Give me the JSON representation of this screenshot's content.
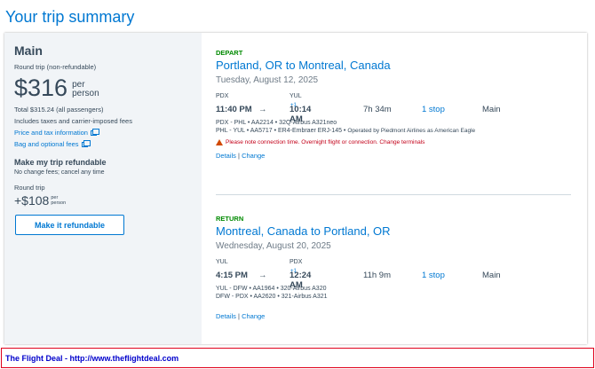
{
  "page_title": "Your trip summary",
  "sidebar": {
    "fare_name": "Main",
    "trip_type": "Round trip (non-refundable)",
    "price": "$316",
    "per_line1": "per",
    "per_line2": "person",
    "total": "Total $315.24 (all passengers)",
    "includes": "Includes taxes and carrier-imposed fees",
    "price_tax_link": "Price and tax information",
    "bag_link": "Bag and optional fees",
    "refundable_heading": "Make my trip refundable",
    "no_change_fees": "No change fees; cancel any time",
    "round_trip_label": "Round trip",
    "upsell_price": "+$108",
    "upsell_per1": "per",
    "upsell_per2": "person",
    "refund_button": "Make it refundable"
  },
  "depart": {
    "tag": "DEPART",
    "route": "Portland, OR to Montreal, Canada",
    "date": "Tuesday, August 12, 2025",
    "from_code": "PDX",
    "to_code": "YUL",
    "dep_time": "11:40 PM",
    "arrow": "→",
    "arr_time": "10:14 AM",
    "arr_plus": "+1",
    "duration": "7h 34m",
    "stops": "1 stop",
    "cabin": "Main",
    "seg1": "PDX - PHL • AA2214 • 32Q-Airbus A321neo",
    "seg2": "PHL - YUL • AA5717 • ER4-Embraer ERJ-145 •",
    "seg2_operator": "Operated by Piedmont Airlines as American Eagle",
    "warning": "Please note connection time. Overnight flight or connection. Change terminals",
    "details_link": "Details",
    "separator": "|",
    "change_link": "Change"
  },
  "return": {
    "tag": "RETURN",
    "route": "Montreal, Canada to Portland, OR",
    "date": "Wednesday, August 20, 2025",
    "from_code": "YUL",
    "to_code": "PDX",
    "dep_time": "4:15 PM",
    "arrow": "→",
    "arr_time": "12:24 AM",
    "arr_plus": "+1",
    "duration": "11h 9m",
    "stops": "1 stop",
    "cabin": "Main",
    "seg1": "YUL - DFW • AA1964 • 320-Airbus A320",
    "seg2": "DFW - PDX • AA2620 • 321-Airbus A321",
    "details_link": "Details",
    "separator": "|",
    "change_link": "Change"
  },
  "footer": {
    "text": "The Flight Deal - http://www.theflightdeal.com"
  },
  "colors": {
    "accent": "#0078d2",
    "depart_tag": "#008a00",
    "warning": "#c30019",
    "footer_border": "#e0001b",
    "footer_text": "#0000cc"
  }
}
